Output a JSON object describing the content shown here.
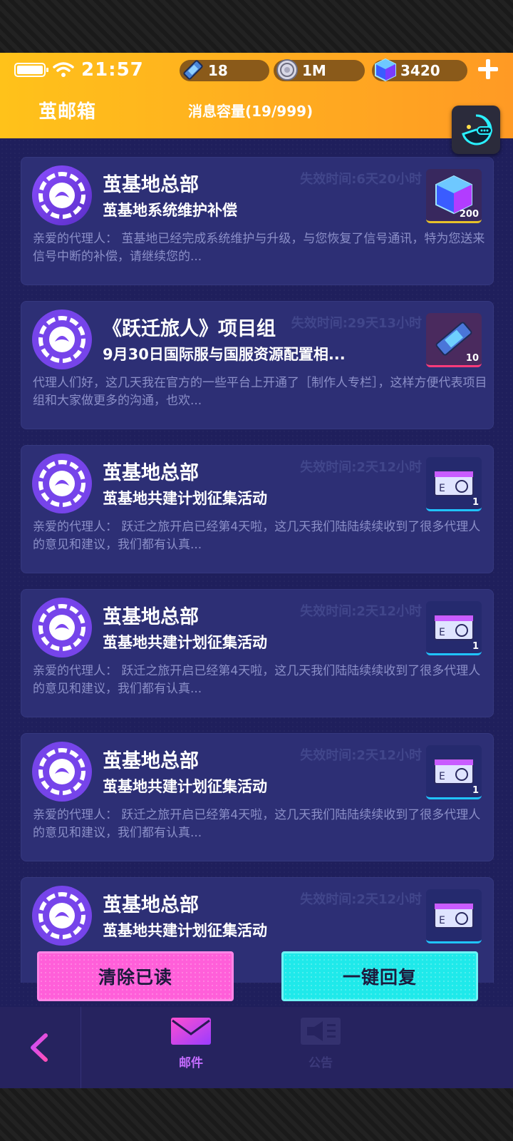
{
  "status_bar": {
    "time": "21:57"
  },
  "currencies": [
    {
      "icon": "ticket-icon",
      "value": "18"
    },
    {
      "icon": "coin-icon",
      "value": "1M"
    },
    {
      "icon": "cube-gem-icon",
      "value": "3420"
    }
  ],
  "header": {
    "title": "茧邮箱",
    "capacity_label": "消息容量",
    "capacity_value": "(19/999)"
  },
  "mails": [
    {
      "sender": "茧基地总部",
      "subject": "茧基地系统维护补偿",
      "expire": "失效时间:6天20小时",
      "preview": "亲爱的代理人： 茧基地已经完成系统维护与升级，与您恢复了信号通讯，特为您送来信号中断的补偿，请继续您的...",
      "reward": {
        "icon": "cube-gem-icon",
        "qty": "200"
      }
    },
    {
      "sender": "《跃迁旅人》项目组",
      "subject": "9月30日国际服与国服资源配置相...",
      "expire": "失效时间:29天13小时",
      "preview": "代理人们好，这几天我在官方的一些平台上开通了［制作人专栏］，这样方便代表项目组和大家做更多的沟通，也欢...",
      "reward": {
        "icon": "ticket-icon",
        "qty": "10"
      }
    },
    {
      "sender": "茧基地总部",
      "subject": "茧基地共建计划征集活动",
      "expire": "失效时间:2天12小时",
      "preview": "亲爱的代理人： 跃迁之旅开启已经第4天啦，这几天我们陆陆续续收到了很多代理人的意见和建议，我们都有认真...",
      "reward": {
        "icon": "ticket-card-icon",
        "qty": "1"
      }
    },
    {
      "sender": "茧基地总部",
      "subject": "茧基地共建计划征集活动",
      "expire": "失效时间:2天12小时",
      "preview": "亲爱的代理人： 跃迁之旅开启已经第4天啦，这几天我们陆陆续续收到了很多代理人的意见和建议，我们都有认真...",
      "reward": {
        "icon": "ticket-card-icon",
        "qty": "1"
      }
    },
    {
      "sender": "茧基地总部",
      "subject": "茧基地共建计划征集活动",
      "expire": "失效时间:2天12小时",
      "preview": "亲爱的代理人： 跃迁之旅开启已经第4天啦，这几天我们陆陆续续收到了很多代理人的意见和建议，我们都有认真...",
      "reward": {
        "icon": "ticket-card-icon",
        "qty": "1"
      }
    },
    {
      "sender": "茧基地总部",
      "subject": "茧基地共建计划征集活动",
      "expire": "失效时间:2天12小时",
      "preview": "",
      "reward": {
        "icon": "ticket-card-icon",
        "qty": ""
      }
    }
  ],
  "actions": {
    "clear_read": "清除已读",
    "reply_all": "一键回复"
  },
  "tabs": {
    "mail": "邮件",
    "notice": "公告"
  },
  "colors": {
    "header_start": "#ffc21a",
    "header_end": "#ff9a24",
    "bg": "#1f1f5c",
    "card": "#2d2f75",
    "clear_btn": "#ff5fd9",
    "reply_btn": "#1fe9ea"
  }
}
